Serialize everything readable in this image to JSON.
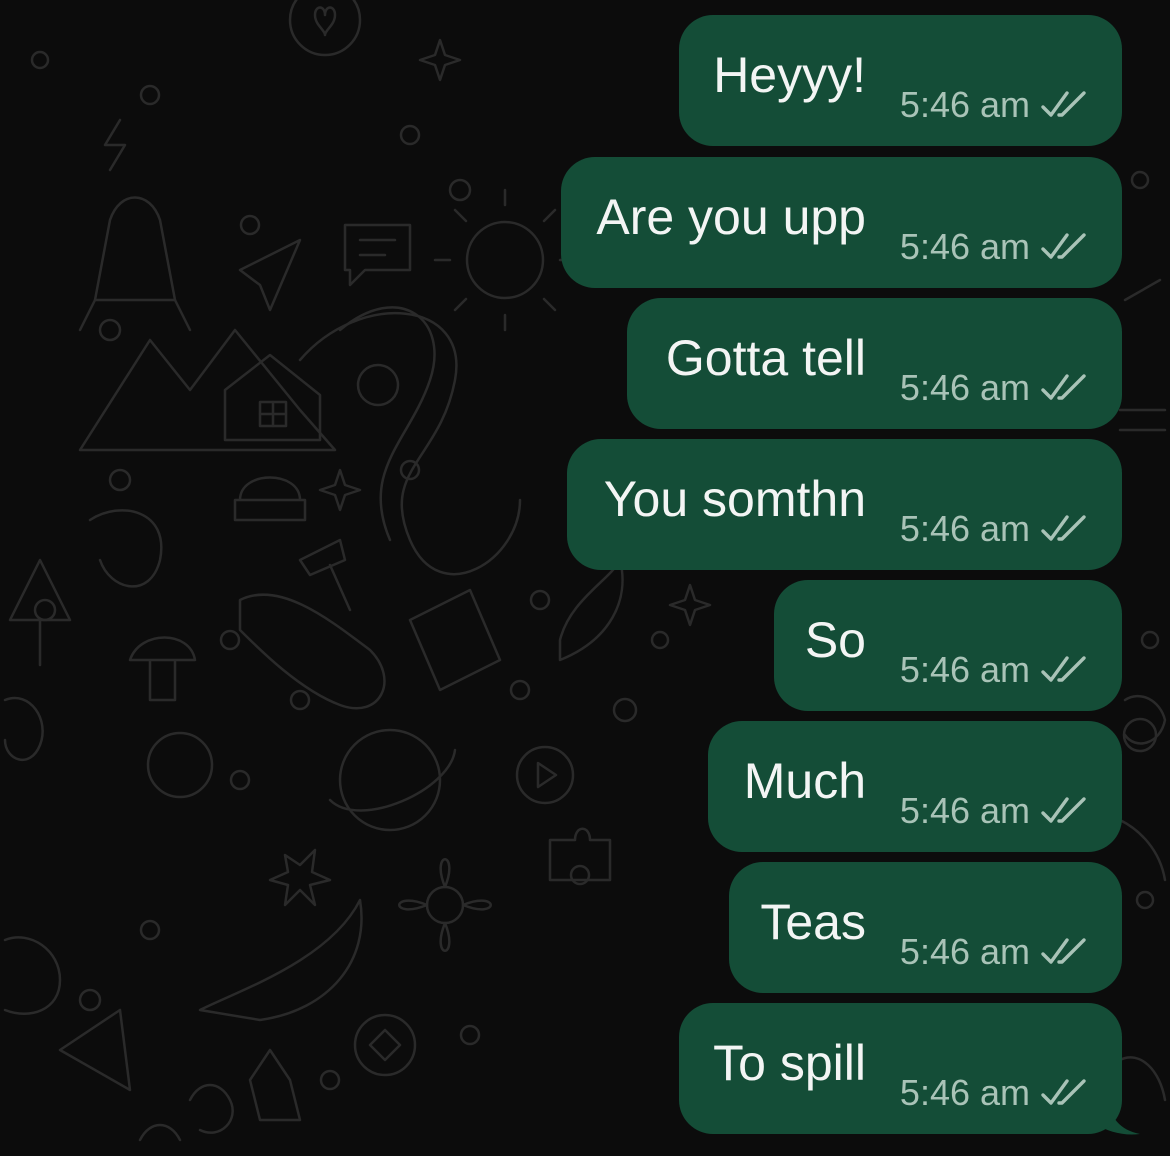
{
  "colors": {
    "background": "#0c0c0c",
    "bubble_outgoing": "#144d37",
    "message_text": "#f3f5f4",
    "timestamp_text": "#a9c3b7",
    "wallpaper_doodle": "#2a2a2a"
  },
  "messages": [
    {
      "text": "Heyyy!",
      "time": "5:46 am",
      "status": "read-double-check-icon"
    },
    {
      "text": "Are you upp",
      "time": "5:46 am",
      "status": "read-double-check-icon"
    },
    {
      "text": "Gotta tell",
      "time": "5:46 am",
      "status": "read-double-check-icon"
    },
    {
      "text": "You somthn",
      "time": "5:46 am",
      "status": "read-double-check-icon"
    },
    {
      "text": "So",
      "time": "5:46 am",
      "status": "read-double-check-icon"
    },
    {
      "text": "Much",
      "time": "5:46 am",
      "status": "read-double-check-icon"
    },
    {
      "text": "Teas",
      "time": "5:46 am",
      "status": "read-double-check-icon"
    },
    {
      "text": "To spill",
      "time": "5:46 am",
      "status": "read-double-check-icon"
    }
  ]
}
